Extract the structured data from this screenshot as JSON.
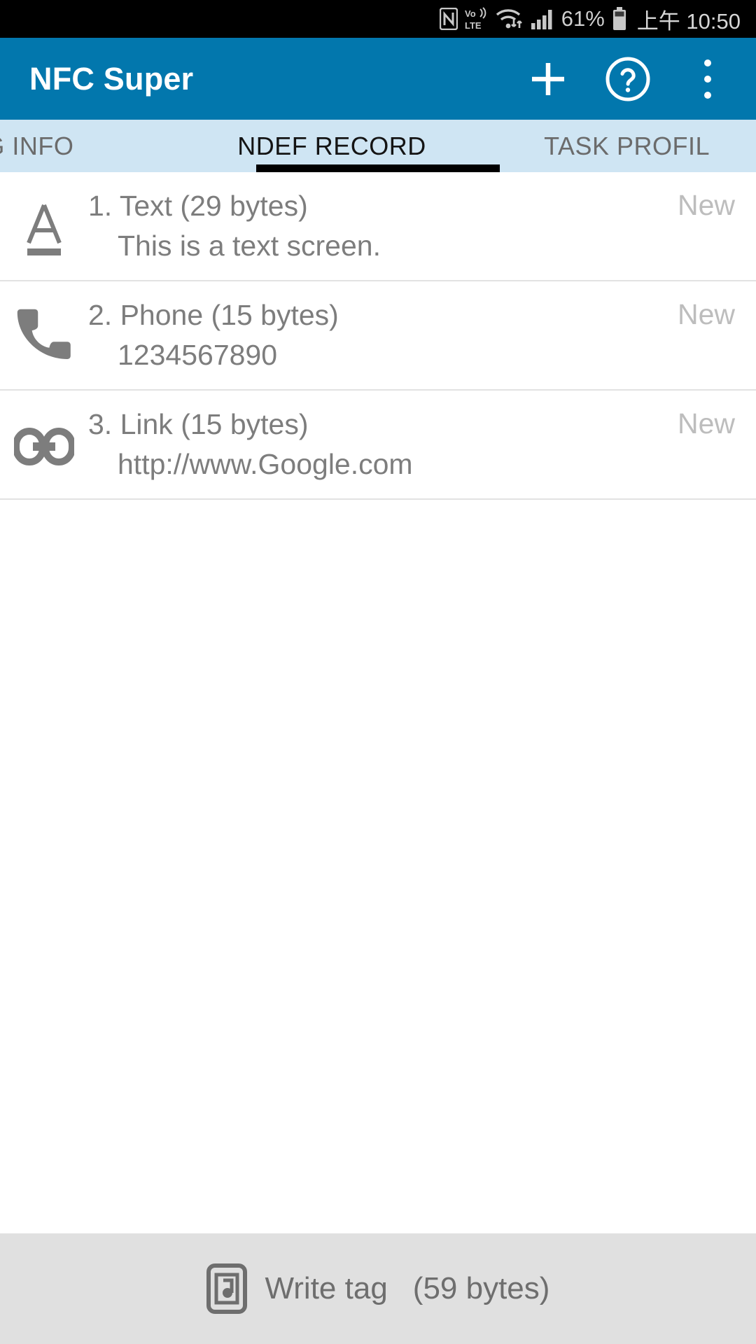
{
  "status_bar": {
    "icons": [
      "nfc-icon",
      "volte-icon",
      "wifi-icon",
      "signal-icon",
      "battery-icon"
    ],
    "volte_top": "Vo))",
    "volte_bottom": "LTE",
    "battery_percent": "61%",
    "clock": "上午 10:50",
    "background": "#000000",
    "foreground": "#cfcfcf"
  },
  "app_bar": {
    "title": "NFC Super",
    "background": "#0277ad",
    "actions": [
      {
        "name": "add-button",
        "icon": "plus-icon"
      },
      {
        "name": "help-button",
        "icon": "help-circle-icon"
      },
      {
        "name": "overflow-button",
        "icon": "more-vertical-icon"
      }
    ]
  },
  "tabs": {
    "background": "#cfe5f3",
    "active_index": 1,
    "indicator_color": "#000000",
    "items": [
      {
        "label": "TAG INFO",
        "active": false
      },
      {
        "label": "NDEF RECORD",
        "active": true
      },
      {
        "label": "TASK PROFIL",
        "active": false
      }
    ]
  },
  "records": [
    {
      "icon": "text-format-icon",
      "title": "1. Text (29 bytes)",
      "subtitle": "This is a text screen.",
      "badge": "New"
    },
    {
      "icon": "phone-icon",
      "title": "2. Phone (15 bytes)",
      "subtitle": "1234567890",
      "badge": "New"
    },
    {
      "icon": "link-icon",
      "title": "3. Link (15 bytes)",
      "subtitle": "http://www.Google.com",
      "badge": "New"
    }
  ],
  "bottom_bar": {
    "icon": "nfc-write-tag-icon",
    "label": "Write tag",
    "bytes": "(59 bytes)",
    "background": "#e0e0e0",
    "foreground": "#6e6e6e"
  }
}
